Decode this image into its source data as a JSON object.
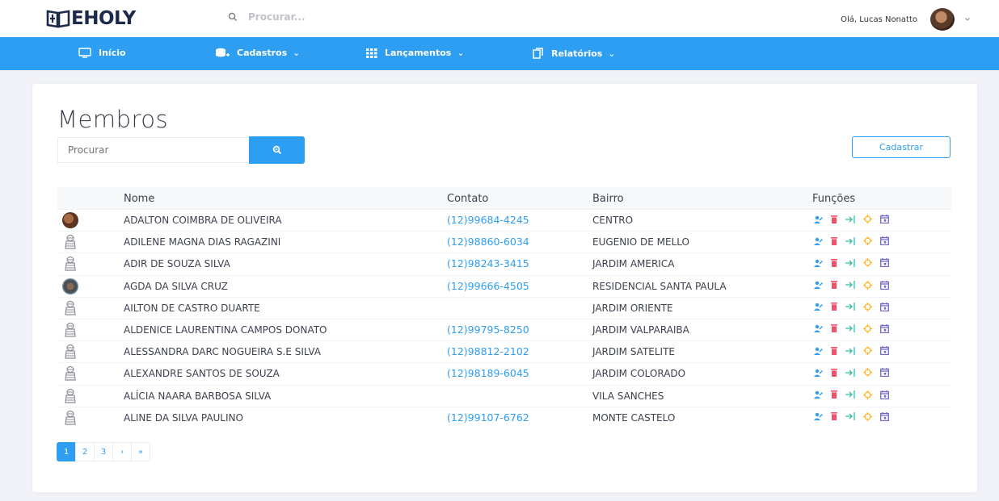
{
  "brand": {
    "name": "EHOLY"
  },
  "topbar": {
    "search_placeholder": "Procurar...",
    "greeting": "Olá, Lucas Nonatto"
  },
  "nav": [
    {
      "label": "Início",
      "dropdown": "",
      "icon": "monitor-icon"
    },
    {
      "label": "Cadastros",
      "dropdown": "⌄",
      "icon": "database-add-icon"
    },
    {
      "label": "Lançamentos",
      "dropdown": "⌄",
      "icon": "grid-icon"
    },
    {
      "label": "Relatórios",
      "dropdown": "⌄",
      "icon": "copy-icon"
    }
  ],
  "page": {
    "title": "Membros",
    "search_placeholder": "Procurar",
    "register_label": "Cadastrar"
  },
  "table": {
    "headers": {
      "name": "Nome",
      "contact": "Contato",
      "district": "Bairro",
      "functions": "Funções"
    },
    "rows": [
      {
        "photo": "photo-1",
        "name": "ADALTON COIMBRA DE OLIVEIRA",
        "contact": "(12)99684-4245",
        "district": "CENTRO"
      },
      {
        "photo": "placeholder",
        "name": "ADILENE MAGNA DIAS RAGAZINI",
        "contact": "(12)98860-6034",
        "district": "EUGENIO DE MELLO"
      },
      {
        "photo": "placeholder",
        "name": "ADIR DE SOUZA SILVA",
        "contact": "(12)98243-3415",
        "district": "JARDIM AMERICA"
      },
      {
        "photo": "photo-2",
        "name": "AGDA DA SILVA CRUZ",
        "contact": "(12)99666-4505",
        "district": "RESIDENCIAL SANTA PAULA"
      },
      {
        "photo": "placeholder",
        "name": "AILTON DE CASTRO DUARTE",
        "contact": "",
        "district": "JARDIM ORIENTE"
      },
      {
        "photo": "placeholder",
        "name": "ALDENICE LAURENTINA CAMPOS DONATO",
        "contact": "(12)99795-8250",
        "district": "JARDIM VALPARAIBA"
      },
      {
        "photo": "placeholder",
        "name": "ALESSANDRA DARC NOGUEIRA S.E SILVA",
        "contact": "(12)98812-2102",
        "district": "JARDIM SATELITE"
      },
      {
        "photo": "placeholder",
        "name": "ALEXANDRE SANTOS DE SOUZA",
        "contact": "(12)98189-6045",
        "district": "JARDIM COLORADO"
      },
      {
        "photo": "placeholder",
        "name": "ALÍCIA NAARA BARBOSA SILVA",
        "contact": "",
        "district": "VILA SANCHES"
      },
      {
        "photo": "placeholder",
        "name": "ALINE DA SILVA PAULINO",
        "contact": "(12)99107-6762",
        "district": "MONTE CASTELO"
      }
    ],
    "action_icons": [
      "user-edit-icon",
      "trash-icon",
      "transfer-icon",
      "target-icon",
      "calendar-icon"
    ]
  },
  "pagination": {
    "pages": [
      "1",
      "2",
      "3",
      "›",
      "»"
    ],
    "active": "1"
  },
  "colors": {
    "primary": "#2e9ef2",
    "edit": "#2e9ef2",
    "delete": "#f4516c",
    "transfer": "#34bfa3",
    "target": "#ffb822",
    "calendar": "#716aca"
  }
}
